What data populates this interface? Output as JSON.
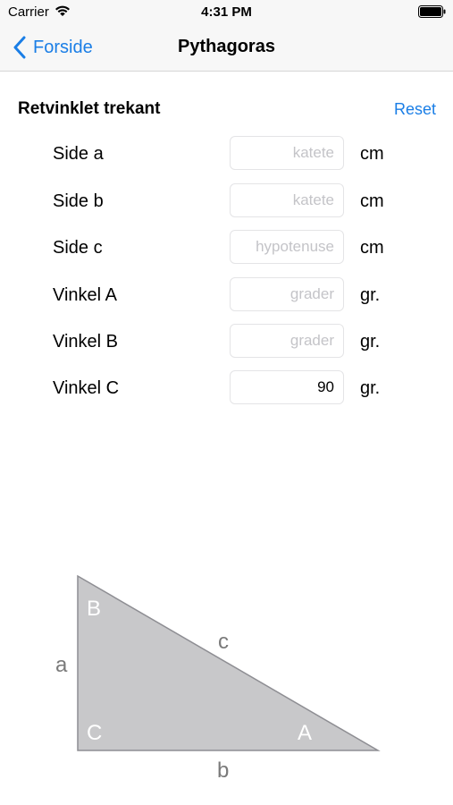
{
  "status_bar": {
    "carrier": "Carrier",
    "time": "4:31 PM",
    "wifi_icon": "wifi-icon",
    "battery_icon": "battery-icon"
  },
  "nav": {
    "back_label": "Forside",
    "back_icon": "chevron-left-icon",
    "title": "Pythagoras"
  },
  "section": {
    "title": "Retvinklet trekant",
    "reset_label": "Reset"
  },
  "rows": [
    {
      "label": "Side a",
      "value": "",
      "placeholder": "katete",
      "unit": "cm"
    },
    {
      "label": "Side b",
      "value": "",
      "placeholder": "katete",
      "unit": "cm"
    },
    {
      "label": "Side c",
      "value": "",
      "placeholder": "hypotenuse",
      "unit": "cm"
    },
    {
      "label": "Vinkel A",
      "value": "",
      "placeholder": "grader",
      "unit": "gr."
    },
    {
      "label": "Vinkel B",
      "value": "",
      "placeholder": "grader",
      "unit": "gr."
    },
    {
      "label": "Vinkel C",
      "value": "90",
      "placeholder": "grader",
      "unit": "gr."
    }
  ],
  "diagram": {
    "side_a": "a",
    "side_b": "b",
    "side_c": "c",
    "vertex_A": "A",
    "vertex_B": "B",
    "vertex_C": "C",
    "fill_color": "#c8c8ca",
    "stroke_color": "#8e8e93"
  },
  "colors": {
    "accent": "#1a7ee6"
  }
}
